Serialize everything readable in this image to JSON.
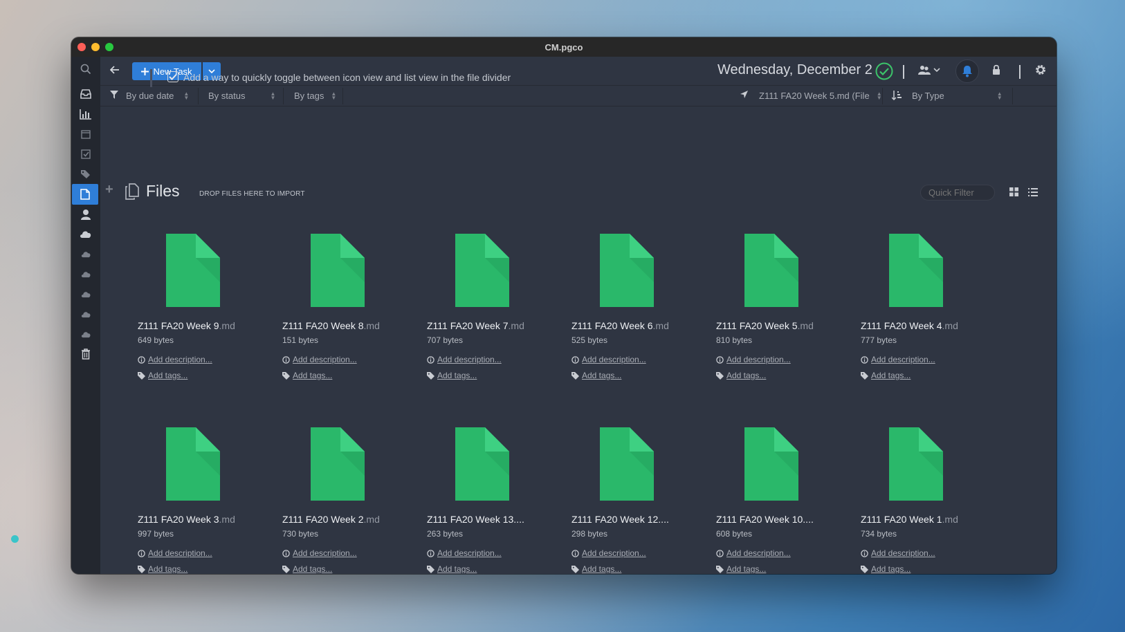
{
  "window": {
    "title": "CM.pgco"
  },
  "toolbar": {
    "new_task_label": "New Task",
    "date": "Wednesday, December 2"
  },
  "sidebar": {
    "items": [
      {
        "icon": "search-icon"
      },
      {
        "icon": "inbox-icon"
      },
      {
        "icon": "chart-icon"
      },
      {
        "icon": "calendar-icon"
      },
      {
        "icon": "checkbox-icon"
      },
      {
        "icon": "tags-icon"
      },
      {
        "icon": "file-icon",
        "active": true
      },
      {
        "icon": "person-icon"
      },
      {
        "icon": "cloud-icon"
      },
      {
        "icon": "cloud-icon"
      },
      {
        "icon": "cloud-icon"
      },
      {
        "icon": "cloud-icon"
      },
      {
        "icon": "cloud-icon"
      },
      {
        "icon": "cloud-icon"
      },
      {
        "icon": "trash-icon"
      }
    ]
  },
  "filterbar": {
    "due_date": "By due date",
    "status": "By status",
    "tags": "By tags",
    "location": "Z111 FA20 Week 5.md (File",
    "sort": "By Type"
  },
  "task": {
    "text": "Add a way to quickly toggle between icon view and list view in the file divider",
    "checked": true
  },
  "files_section": {
    "title": "Files",
    "drop_hint": "DROP FILES HERE TO IMPORT",
    "quick_filter_placeholder": "Quick Filter",
    "add_description": "Add description...",
    "add_tags": "Add tags..."
  },
  "files": [
    {
      "name": "Z111 FA20 Week 9",
      "ext": ".md",
      "size": "649 bytes"
    },
    {
      "name": "Z111 FA20 Week 8",
      "ext": ".md",
      "size": "151 bytes"
    },
    {
      "name": "Z111 FA20 Week 7",
      "ext": ".md",
      "size": "707 bytes"
    },
    {
      "name": "Z111 FA20 Week 6",
      "ext": ".md",
      "size": "525 bytes"
    },
    {
      "name": "Z111 FA20 Week 5",
      "ext": ".md",
      "size": "810 bytes"
    },
    {
      "name": "Z111 FA20 Week 4",
      "ext": ".md",
      "size": "777 bytes"
    },
    {
      "name": "Z111 FA20 Week 3",
      "ext": ".md",
      "size": "997 bytes"
    },
    {
      "name": "Z111 FA20 Week 2",
      "ext": ".md",
      "size": "730 bytes"
    },
    {
      "name": "Z111 FA20 Week 13....",
      "ext": "",
      "size": "263 bytes"
    },
    {
      "name": "Z111 FA20 Week 12....",
      "ext": "",
      "size": "298 bytes"
    },
    {
      "name": "Z111 FA20 Week 10....",
      "ext": "",
      "size": "608 bytes"
    },
    {
      "name": "Z111 FA20 Week 1",
      "ext": ".md",
      "size": "734 bytes"
    }
  ],
  "colors": {
    "accent": "#2f7ed8",
    "file_green": "#2ab86a",
    "file_fold": "#3ed082",
    "check_green": "#3cc46a",
    "window_bg": "#2f3542",
    "sidebar_bg": "#23272f",
    "status_dot": "#3ac4c9"
  }
}
